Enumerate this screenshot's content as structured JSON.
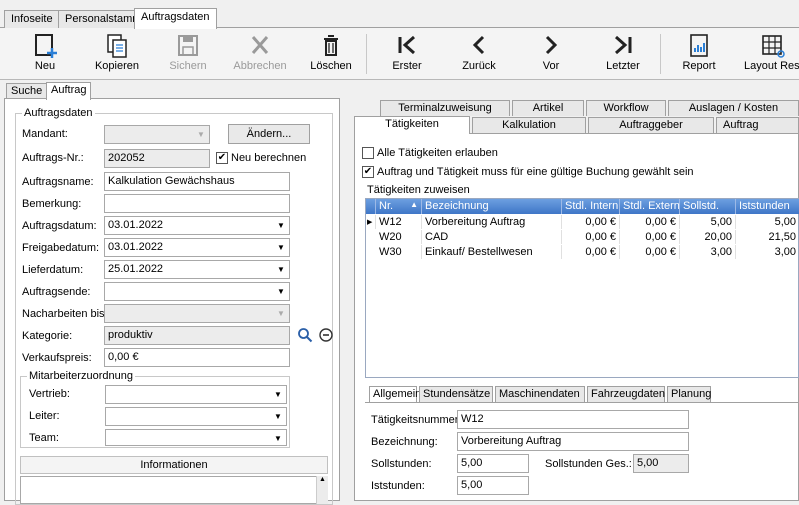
{
  "top_tabs": [
    "Infoseite",
    "Personalstamm",
    "Auftragsdaten"
  ],
  "toolbar": {
    "new": "Neu",
    "copy": "Kopieren",
    "save": "Sichern",
    "cancel": "Abbrechen",
    "delete": "Löschen",
    "first": "Erster",
    "back": "Zurück",
    "next": "Vor",
    "last": "Letzter",
    "report": "Report",
    "layout": "Layout Res"
  },
  "left_tabs": [
    "Suche",
    "Auftrag"
  ],
  "auftrag": {
    "group_title": "Auftragsdaten",
    "mandant_label": "Mandant:",
    "mandant_value": "",
    "aendern_button": "Ändern...",
    "auftragsnr_label": "Auftrags-Nr.:",
    "auftragsnr_value": "202052",
    "neu_berechnen": "Neu berechnen",
    "auftragsname_label": "Auftragsname:",
    "auftragsname_value": "Kalkulation Gewächshaus",
    "bemerkung_label": "Bemerkung:",
    "bemerkung_value": "",
    "auftragsdatum_label": "Auftragsdatum:",
    "auftragsdatum_value": "03.01.2022",
    "freigabedatum_label": "Freigabedatum:",
    "freigabedatum_value": "03.01.2022",
    "lieferdatum_label": "Lieferdatum:",
    "lieferdatum_value": "25.01.2022",
    "auftragsende_label": "Auftragsende:",
    "auftragsende_value": "",
    "nacharbeiten_label": "Nacharbeiten bis:",
    "nacharbeiten_value": "",
    "kategorie_label": "Kategorie:",
    "kategorie_value": "produktiv",
    "verkaufspreis_label": "Verkaufspreis:",
    "verkaufspreis_value": "0,00 €"
  },
  "mitarbeiter": {
    "group_title": "Mitarbeiterzuordnung",
    "vertrieb_label": "Vertrieb:",
    "leiter_label": "Leiter:",
    "team_label": "Team:"
  },
  "informationen": {
    "title": "Informationen",
    "value": ""
  },
  "right_tabs_row1": [
    "Terminalzuweisung",
    "Artikel",
    "Workflow",
    "Auslagen / Kosten"
  ],
  "right_tabs_row2": [
    "Tätigkeiten",
    "Kalkulation",
    "Auftraggeber",
    "Auftrag"
  ],
  "taetigkeiten": {
    "alle_erlauben": "Alle Tätigkeiten erlauben",
    "gueltig": "Auftrag und Tätigkeit muss für eine gültige Buchung gewählt sein",
    "zuweisen_title": "Tätigkeiten zuweisen",
    "columns": [
      "Nr.",
      "Bezeichnung",
      "Stdl. Intern",
      "Stdl. Extern",
      "Sollstd.",
      "Iststunden"
    ],
    "rows": [
      {
        "nr": "W12",
        "bez": "Vorbereitung Auftrag",
        "intern": "0,00 €",
        "extern": "0,00 €",
        "soll": "5,00",
        "ist": "5,00"
      },
      {
        "nr": "W20",
        "bez": "CAD",
        "intern": "0,00 €",
        "extern": "0,00 €",
        "soll": "20,00",
        "ist": "21,50"
      },
      {
        "nr": "W30",
        "bez": "Einkauf/ Bestellwesen",
        "intern": "0,00 €",
        "extern": "0,00 €",
        "soll": "3,00",
        "ist": "3,00"
      }
    ]
  },
  "bottom_tabs": [
    "Allgemein",
    "Stundensätze",
    "Maschinendaten",
    "Fahrzeugdaten",
    "Planung"
  ],
  "allgemein": {
    "nummer_label": "Tätigkeitsnummer:",
    "nummer_value": "W12",
    "bez_label": "Bezeichnung:",
    "bez_value": "Vorbereitung Auftrag",
    "soll_label": "Sollstunden:",
    "soll_value": "5,00",
    "soll_ges_label": "Sollstunden Ges.:",
    "soll_ges_value": "5,00",
    "ist_label": "Iststunden:",
    "ist_value": "5,00"
  }
}
